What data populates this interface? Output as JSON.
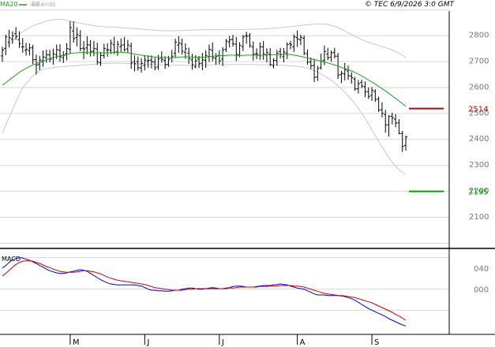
{
  "chart_data": {
    "type": "candlestick",
    "legend": {
      "ma_label": "MA20",
      "ma_color": "#1aa31a",
      "bb_label": "BBands",
      "bb_color": "#c8c8c8"
    },
    "copyright": "© TEC 6/9/2026 3:0 GMT",
    "main": {
      "ylim": [
        1990,
        2890
      ],
      "yticks": [
        "2800",
        "2700",
        "2600",
        "2500",
        "2400",
        "2300",
        "2200",
        "2100"
      ],
      "ytick_values": [
        2800,
        2700,
        2600,
        2500,
        2400,
        2300,
        2200,
        2100
      ],
      "gridlines": [
        2895,
        2795,
        2695,
        2595,
        2495,
        2395,
        2295,
        2195,
        2095,
        1995
      ],
      "levels": [
        {
          "label": "2514",
          "value": 2514,
          "color": "#c00000"
        },
        {
          "label": "2195",
          "value": 2195,
          "color": "#00a000"
        }
      ],
      "bars": [
        [
          2717,
          2752,
          2694,
          2739
        ],
        [
          2746,
          2799,
          2720,
          2790
        ],
        [
          2770,
          2818,
          2749,
          2787
        ],
        [
          2781,
          2812,
          2764,
          2795
        ],
        [
          2803,
          2828,
          2779,
          2792
        ],
        [
          2780,
          2812,
          2748,
          2764
        ],
        [
          2752,
          2786,
          2729,
          2752
        ],
        [
          2739,
          2767,
          2718,
          2743
        ],
        [
          2738,
          2765,
          2719,
          2748
        ],
        [
          2748,
          2760,
          2685,
          2702
        ],
        [
          2703,
          2722,
          2645,
          2682
        ],
        [
          2684,
          2717,
          2662,
          2701
        ],
        [
          2698,
          2738,
          2675,
          2713
        ],
        [
          2710,
          2741,
          2691,
          2721
        ],
        [
          2721,
          2740,
          2693,
          2704
        ],
        [
          2708,
          2745,
          2683,
          2725
        ],
        [
          2722,
          2761,
          2705,
          2741
        ],
        [
          2739,
          2762,
          2695,
          2714
        ],
        [
          2710,
          2735,
          2690,
          2719
        ],
        [
          2726,
          2766,
          2700,
          2745
        ],
        [
          2743,
          2851,
          2725,
          2826
        ],
        [
          2813,
          2850,
          2768,
          2784
        ],
        [
          2788,
          2827,
          2754,
          2799
        ],
        [
          2795,
          2816,
          2735,
          2745
        ],
        [
          2747,
          2774,
          2704,
          2744
        ],
        [
          2748,
          2793,
          2723,
          2760
        ],
        [
          2759,
          2778,
          2715,
          2734
        ],
        [
          2735,
          2775,
          2716,
          2745
        ],
        [
          2744,
          2768,
          2683,
          2694
        ],
        [
          2691,
          2732,
          2678,
          2719
        ],
        [
          2719,
          2764,
          2707,
          2746
        ],
        [
          2740,
          2766,
          2714,
          2741
        ],
        [
          2739,
          2780,
          2724,
          2766
        ],
        [
          2760,
          2791,
          2724,
          2731
        ],
        [
          2733,
          2775,
          2717,
          2762
        ],
        [
          2752,
          2785,
          2733,
          2757
        ],
        [
          2760,
          2790,
          2734,
          2741
        ],
        [
          2744,
          2779,
          2728,
          2759
        ],
        [
          2755,
          2768,
          2667,
          2690
        ],
        [
          2695,
          2719,
          2658,
          2687
        ],
        [
          2695,
          2715,
          2660,
          2672
        ],
        [
          2670,
          2708,
          2653,
          2688
        ],
        [
          2680,
          2720,
          2661,
          2701
        ],
        [
          2696,
          2720,
          2672,
          2700
        ],
        [
          2701,
          2719,
          2669,
          2695
        ],
        [
          2693,
          2710,
          2661,
          2671
        ],
        [
          2675,
          2721,
          2663,
          2705
        ],
        [
          2710,
          2734,
          2691,
          2704
        ],
        [
          2700,
          2716,
          2667,
          2683
        ],
        [
          2685,
          2717,
          2675,
          2704
        ],
        [
          2710,
          2740,
          2692,
          2716
        ],
        [
          2727,
          2784,
          2709,
          2770
        ],
        [
          2759,
          2793,
          2729,
          2767
        ],
        [
          2763,
          2784,
          2722,
          2735
        ],
        [
          2731,
          2765,
          2706,
          2744
        ],
        [
          2728,
          2749,
          2686,
          2707
        ],
        [
          2702,
          2725,
          2664,
          2683
        ],
        [
          2676,
          2720,
          2669,
          2698
        ],
        [
          2705,
          2717,
          2670,
          2687
        ],
        [
          2689,
          2729,
          2662,
          2702
        ],
        [
          2700,
          2739,
          2671,
          2719
        ],
        [
          2715,
          2761,
          2694,
          2742
        ],
        [
          2739,
          2769,
          2697,
          2711
        ],
        [
          2708,
          2728,
          2683,
          2715
        ],
        [
          2719,
          2739,
          2685,
          2698
        ],
        [
          2705,
          2751,
          2678,
          2740
        ],
        [
          2743,
          2783,
          2732,
          2774
        ],
        [
          2771,
          2794,
          2750,
          2779
        ],
        [
          2781,
          2798,
          2753,
          2764
        ],
        [
          2762,
          2790,
          2697,
          2723
        ],
        [
          2721,
          2770,
          2712,
          2757
        ],
        [
          2753,
          2798,
          2736,
          2790
        ],
        [
          2795,
          2810,
          2764,
          2793
        ],
        [
          2795,
          2805,
          2749,
          2756
        ],
        [
          2751,
          2773,
          2699,
          2723
        ],
        [
          2725,
          2746,
          2704,
          2724
        ],
        [
          2719,
          2769,
          2702,
          2752
        ],
        [
          2752,
          2774,
          2702,
          2724
        ],
        [
          2721,
          2746,
          2692,
          2730
        ],
        [
          2724,
          2747,
          2678,
          2684
        ],
        [
          2680,
          2708,
          2669,
          2700
        ],
        [
          2699,
          2740,
          2679,
          2728
        ],
        [
          2734,
          2748,
          2707,
          2722
        ],
        [
          2714,
          2747,
          2692,
          2732
        ],
        [
          2728,
          2769,
          2705,
          2761
        ],
        [
          2764,
          2775,
          2742,
          2760
        ],
        [
          2752,
          2800,
          2732,
          2791
        ],
        [
          2788,
          2815,
          2752,
          2782
        ],
        [
          2779,
          2799,
          2759,
          2789
        ],
        [
          2785,
          2796,
          2720,
          2728
        ],
        [
          2725,
          2742,
          2683,
          2694
        ],
        [
          2693,
          2711,
          2666,
          2679
        ],
        [
          2680,
          2706,
          2616,
          2634
        ],
        [
          2636,
          2679,
          2620,
          2668
        ],
        [
          2672,
          2726,
          2664,
          2697
        ],
        [
          2700,
          2757,
          2681,
          2734
        ],
        [
          2724,
          2748,
          2701,
          2710
        ],
        [
          2712,
          2738,
          2695,
          2729
        ],
        [
          2731,
          2748,
          2707,
          2716
        ],
        [
          2716,
          2728,
          2628,
          2643
        ],
        [
          2645,
          2660,
          2612,
          2650
        ],
        [
          2648,
          2690,
          2623,
          2664
        ],
        [
          2659,
          2680,
          2625,
          2641
        ],
        [
          2639,
          2654,
          2610,
          2633
        ],
        [
          2628,
          2636,
          2583,
          2590
        ],
        [
          2590,
          2624,
          2572,
          2610
        ],
        [
          2615,
          2625,
          2593,
          2601
        ],
        [
          2598,
          2619,
          2558,
          2578
        ],
        [
          2580,
          2596,
          2551,
          2561
        ],
        [
          2565,
          2597,
          2544,
          2584
        ],
        [
          2580,
          2589,
          2540,
          2550
        ],
        [
          2550,
          2560,
          2501,
          2508
        ],
        [
          2510,
          2538,
          2480,
          2496
        ],
        [
          2491,
          2509,
          2421,
          2450
        ],
        [
          2452,
          2489,
          2406,
          2483
        ],
        [
          2485,
          2498,
          2453,
          2478
        ],
        [
          2473,
          2492,
          2442,
          2458
        ],
        [
          2459,
          2473,
          2415,
          2418
        ],
        [
          2418,
          2428,
          2347,
          2368
        ],
        [
          2372,
          2410,
          2352,
          2404
        ]
      ],
      "ma20": [
        2604,
        2614,
        2624,
        2634,
        2644,
        2654,
        2662,
        2670,
        2676,
        2682,
        2687,
        2692,
        2697,
        2702,
        2706,
        2710,
        2714,
        2717,
        2720,
        2723,
        2726,
        2728,
        2729,
        2730,
        2730,
        2730,
        2730,
        2729,
        2729,
        2729,
        2729,
        2729,
        2730,
        2731,
        2731,
        2731,
        2730,
        2729,
        2727,
        2724,
        2722,
        2720,
        2718,
        2716,
        2714,
        2713,
        2712,
        2711,
        2711,
        2710,
        2710,
        2711,
        2712,
        2713,
        2714,
        2713,
        2713,
        2712,
        2712,
        2712,
        2713,
        2714,
        2716,
        2717,
        2718,
        2718,
        2719,
        2720,
        2720,
        2719,
        2719,
        2719,
        2720,
        2720,
        2720,
        2719,
        2719,
        2720,
        2720,
        2721,
        2722,
        2722,
        2723,
        2723,
        2723,
        2722,
        2720,
        2718,
        2715,
        2712,
        2709,
        2706,
        2703,
        2700,
        2697,
        2694,
        2690,
        2686,
        2682,
        2678,
        2673,
        2668,
        2664,
        2659,
        2653,
        2647,
        2640,
        2632,
        2624,
        2616,
        2608,
        2600,
        2591,
        2582,
        2573,
        2563,
        2553,
        2543,
        2533,
        2523
      ],
      "bb_upper": [
        2740,
        2752,
        2764,
        2776,
        2788,
        2800,
        2810,
        2819,
        2826,
        2833,
        2838,
        2843,
        2847,
        2851,
        2854,
        2857,
        2858,
        2858,
        2857,
        2855,
        2852,
        2849,
        2846,
        2843,
        2840,
        2838,
        2836,
        2834,
        2832,
        2831,
        2830,
        2829,
        2829,
        2828,
        2827,
        2826,
        2825,
        2824,
        2823,
        2822,
        2821,
        2820,
        2819,
        2818,
        2817,
        2816,
        2815,
        2815,
        2814,
        2814,
        2814,
        2814,
        2815,
        2815,
        2816,
        2816,
        2817,
        2817,
        2818,
        2818,
        2818,
        2818,
        2818,
        2818,
        2818,
        2818,
        2819,
        2819,
        2819,
        2819,
        2819,
        2819,
        2819,
        2820,
        2820,
        2820,
        2821,
        2821,
        2822,
        2823,
        2824,
        2825,
        2826,
        2827,
        2828,
        2830,
        2831,
        2833,
        2834,
        2836,
        2837,
        2838,
        2839,
        2840,
        2840,
        2840,
        2838,
        2835,
        2831,
        2826,
        2820,
        2813,
        2806,
        2799,
        2792,
        2786,
        2780,
        2774,
        2769,
        2765,
        2761,
        2757,
        2753,
        2749,
        2745,
        2740,
        2734,
        2728,
        2720,
        2710
      ],
      "bb_lower": [
        2420,
        2450,
        2480,
        2510,
        2540,
        2570,
        2595,
        2610,
        2625,
        2640,
        2650,
        2660,
        2665,
        2668,
        2670,
        2672,
        2674,
        2675,
        2676,
        2677,
        2678,
        2679,
        2680,
        2681,
        2682,
        2683,
        2684,
        2685,
        2686,
        2687,
        2688,
        2688,
        2689,
        2689,
        2689,
        2689,
        2688,
        2688,
        2687,
        2686,
        2686,
        2686,
        2685,
        2685,
        2684,
        2684,
        2683,
        2683,
        2682,
        2682,
        2681,
        2681,
        2681,
        2681,
        2681,
        2681,
        2681,
        2681,
        2681,
        2682,
        2682,
        2682,
        2682,
        2683,
        2683,
        2683,
        2683,
        2684,
        2684,
        2684,
        2684,
        2684,
        2684,
        2684,
        2684,
        2683,
        2683,
        2683,
        2683,
        2683,
        2682,
        2682,
        2681,
        2681,
        2680,
        2679,
        2678,
        2677,
        2675,
        2672,
        2669,
        2665,
        2660,
        2654,
        2647,
        2640,
        2632,
        2623,
        2613,
        2602,
        2590,
        2577,
        2563,
        2548,
        2532,
        2514,
        2495,
        2475,
        2454,
        2432,
        2410,
        2388,
        2366,
        2345,
        2325,
        2307,
        2291,
        2278,
        2268,
        2262
      ]
    },
    "macd": {
      "label": "MACD",
      "ylim": [
        -80,
        70
      ],
      "yticks": [
        "040",
        "000"
      ],
      "ytick_values": [
        40,
        0
      ],
      "gridlines": [
        60,
        0,
        -40
      ],
      "macd_color": "#0000cc",
      "signal_color": "#cc0000",
      "macd": [
        40,
        45,
        51,
        56,
        58,
        60,
        59,
        57,
        55,
        52,
        49,
        45,
        42,
        38,
        35,
        33,
        31,
        30,
        30,
        31,
        33,
        34,
        36,
        37,
        36,
        34,
        30,
        26,
        22,
        18,
        15,
        12,
        10,
        9,
        8,
        8,
        8,
        8,
        8,
        8,
        7,
        6,
        3,
        0,
        -2,
        -2,
        -3,
        -3,
        -4,
        -4,
        -3,
        -2,
        -2,
        0,
        1,
        2,
        2,
        1,
        0,
        0,
        1,
        2,
        3,
        2,
        1,
        1,
        2,
        3,
        5,
        6,
        6,
        5,
        4,
        4,
        4,
        5,
        6,
        7,
        7,
        7,
        8,
        9,
        10,
        9,
        8,
        6,
        4,
        2,
        1,
        0,
        -3,
        -6,
        -9,
        -11,
        -11,
        -11,
        -12,
        -12,
        -12,
        -12,
        -13,
        -14,
        -16,
        -18,
        -21,
        -25,
        -29,
        -33,
        -37,
        -40,
        -43,
        -46,
        -49,
        -52,
        -56,
        -59,
        -62,
        -65,
        -68,
        -70
      ],
      "signal": [
        25,
        30,
        36,
        42,
        47,
        51,
        53,
        54,
        54,
        53,
        51,
        49,
        46,
        43,
        41,
        38,
        36,
        34,
        33,
        32,
        32,
        32,
        33,
        34,
        35,
        35,
        34,
        33,
        31,
        29,
        26,
        23,
        21,
        19,
        17,
        16,
        15,
        14,
        13,
        12,
        11,
        10,
        9,
        7,
        5,
        3,
        2,
        1,
        0,
        -1,
        -2,
        -2,
        -2,
        -2,
        -1,
        0,
        0,
        1,
        1,
        1,
        1,
        1,
        1,
        1,
        1,
        1,
        1,
        2,
        2,
        3,
        4,
        4,
        4,
        4,
        4,
        4,
        5,
        5,
        5,
        6,
        6,
        6,
        7,
        7,
        7,
        7,
        6,
        6,
        5,
        4,
        2,
        0,
        -2,
        -4,
        -6,
        -8,
        -9,
        -10,
        -11,
        -12,
        -12,
        -13,
        -14,
        -15,
        -16,
        -18,
        -20,
        -22,
        -24,
        -26,
        -29,
        -32,
        -35,
        -38,
        -41,
        -44,
        -48,
        -51,
        -55,
        -59
      ]
    },
    "xaxis": {
      "labels": [
        "M",
        "J",
        "J",
        "A",
        "S"
      ],
      "positions": [
        20,
        42,
        64,
        87,
        109
      ]
    }
  }
}
